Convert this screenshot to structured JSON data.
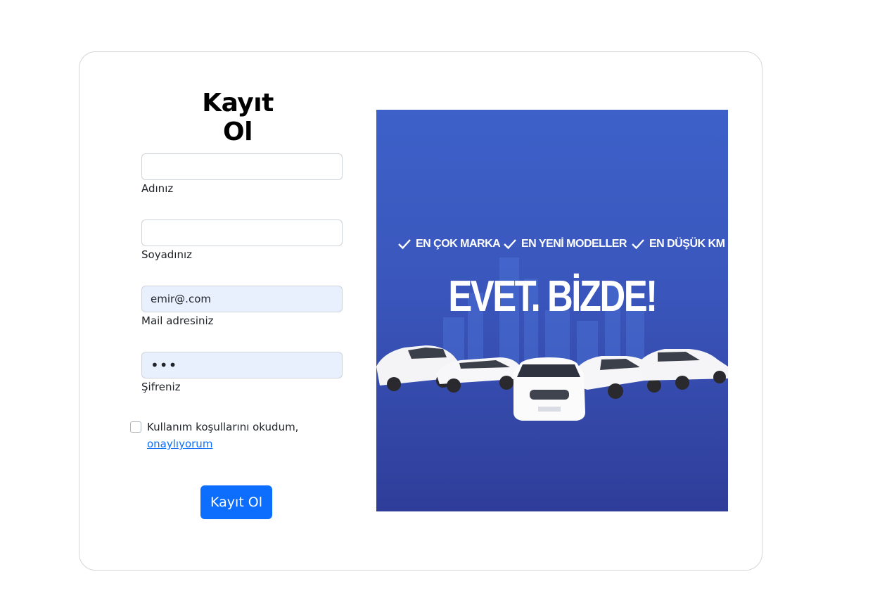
{
  "page": {
    "title": "Kayıt Ol"
  },
  "form": {
    "first_name": {
      "label": "Adınız",
      "value": ""
    },
    "last_name": {
      "label": "Soyadınız",
      "value": ""
    },
    "email": {
      "label": "Mail adresiniz",
      "value": "emir@.com"
    },
    "password": {
      "label": "Şifreniz",
      "value": "•••"
    },
    "terms": {
      "text": "Kullanım koşullarını okudum,",
      "link": "onaylıyorum",
      "checked": false
    },
    "submit_label": "Kayıt Ol"
  },
  "banner": {
    "features": [
      "EN ÇOK MARKA",
      "EN YENİ MODELLER",
      "EN DÜŞÜK KM"
    ],
    "slogan": "EVET. BİZDE!"
  },
  "colors": {
    "primary": "#0d6efd",
    "banner_top": "#3d61c9",
    "banner_bottom": "#2f3d99",
    "autofill_bg": "#e8f0fe"
  }
}
